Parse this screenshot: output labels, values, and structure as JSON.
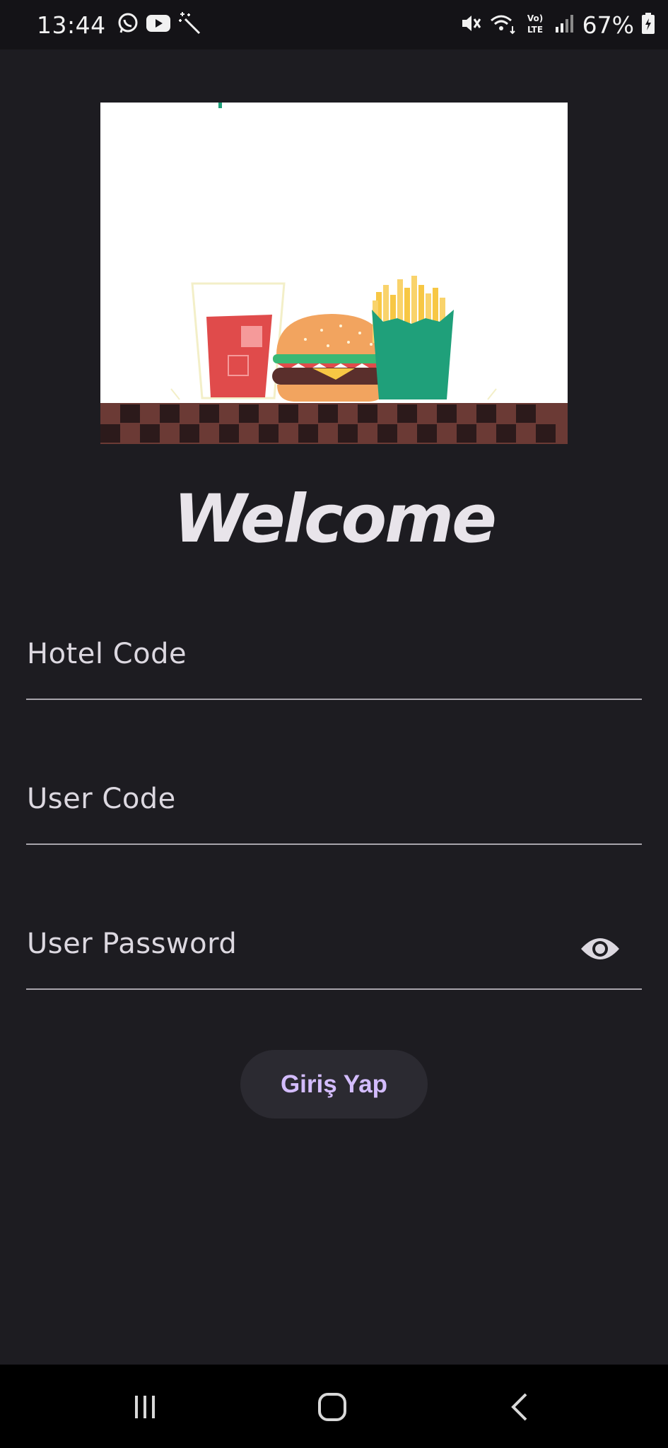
{
  "status_bar": {
    "time": "13:44",
    "left_icons": [
      "whatsapp-icon",
      "youtube-icon",
      "magic-wand-icon"
    ],
    "right_icons": [
      "mute-icon",
      "wifi-icon",
      "volte-lte-icon",
      "signal-icon",
      "battery-icon"
    ],
    "battery": "67%"
  },
  "header": {
    "illustration": "fast-food-illustration",
    "title": "Welcome"
  },
  "form": {
    "hotel_code": {
      "label": "Hotel Code",
      "value": ""
    },
    "user_code": {
      "label": "User Code",
      "value": ""
    },
    "user_password": {
      "label": "User Password",
      "value": "",
      "toggle_icon": "eye-icon"
    }
  },
  "actions": {
    "login_label": "Giriş Yap"
  },
  "colors": {
    "background": "#1d1c21",
    "button_background": "#2b2a31",
    "button_text": "#d3bcfd",
    "status_bar": "#141317",
    "nav_bar": "#000000"
  },
  "nav_bar": {
    "buttons": [
      "recent-apps-icon",
      "home-icon",
      "back-icon"
    ]
  }
}
